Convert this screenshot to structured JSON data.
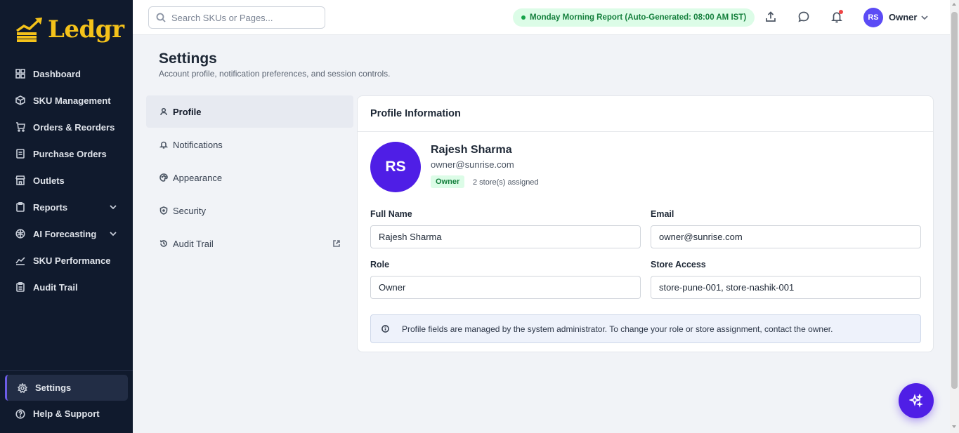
{
  "app": {
    "name": "Ledgr"
  },
  "sidebar": {
    "items": [
      {
        "label": "Dashboard",
        "icon": "dashboard-icon"
      },
      {
        "label": "SKU Management",
        "icon": "box-icon"
      },
      {
        "label": "Orders & Reorders",
        "icon": "cart-icon"
      },
      {
        "label": "Purchase Orders",
        "icon": "document-icon"
      },
      {
        "label": "Outlets",
        "icon": "store-icon"
      },
      {
        "label": "Reports",
        "icon": "clipboard-icon",
        "expandable": true
      },
      {
        "label": "AI Forecasting",
        "icon": "brain-icon",
        "expandable": true
      },
      {
        "label": "SKU Performance",
        "icon": "trend-icon"
      },
      {
        "label": "Audit Trail",
        "icon": "clipboard-list-icon"
      }
    ],
    "bottom": [
      {
        "label": "Settings",
        "icon": "gear-icon",
        "active": true
      },
      {
        "label": "Help & Support",
        "icon": "help-icon"
      }
    ]
  },
  "topbar": {
    "search_placeholder": "Search SKUs or Pages...",
    "report_status": "Monday Morning Report (Auto-Generated: 08:00 AM IST)",
    "user_initials": "RS",
    "user_role": "Owner"
  },
  "page": {
    "title": "Settings",
    "subtitle": "Account profile, notification preferences, and session controls."
  },
  "tabs": [
    {
      "label": "Profile",
      "active": true
    },
    {
      "label": "Notifications"
    },
    {
      "label": "Appearance"
    },
    {
      "label": "Security"
    },
    {
      "label": "Audit Trail",
      "external": true
    }
  ],
  "profile": {
    "card_title": "Profile Information",
    "initials": "RS",
    "name": "Rajesh Sharma",
    "email": "owner@sunrise.com",
    "role_badge": "Owner",
    "stores_assigned": "2 store(s) assigned",
    "fields": {
      "full_name_label": "Full Name",
      "full_name_value": "Rajesh Sharma",
      "email_label": "Email",
      "email_value": "owner@sunrise.com",
      "role_label": "Role",
      "role_value": "Owner",
      "store_access_label": "Store Access",
      "store_access_value": "store-pune-001, store-nashik-001"
    },
    "info_note": "Profile fields are managed by the system administrator. To change your role or store assignment, contact the owner."
  },
  "colors": {
    "sidebar_bg": "#101a2d",
    "brand_gold": "#f4c21a",
    "accent_purple": "#4f1ee6",
    "status_green": "#15803d"
  }
}
